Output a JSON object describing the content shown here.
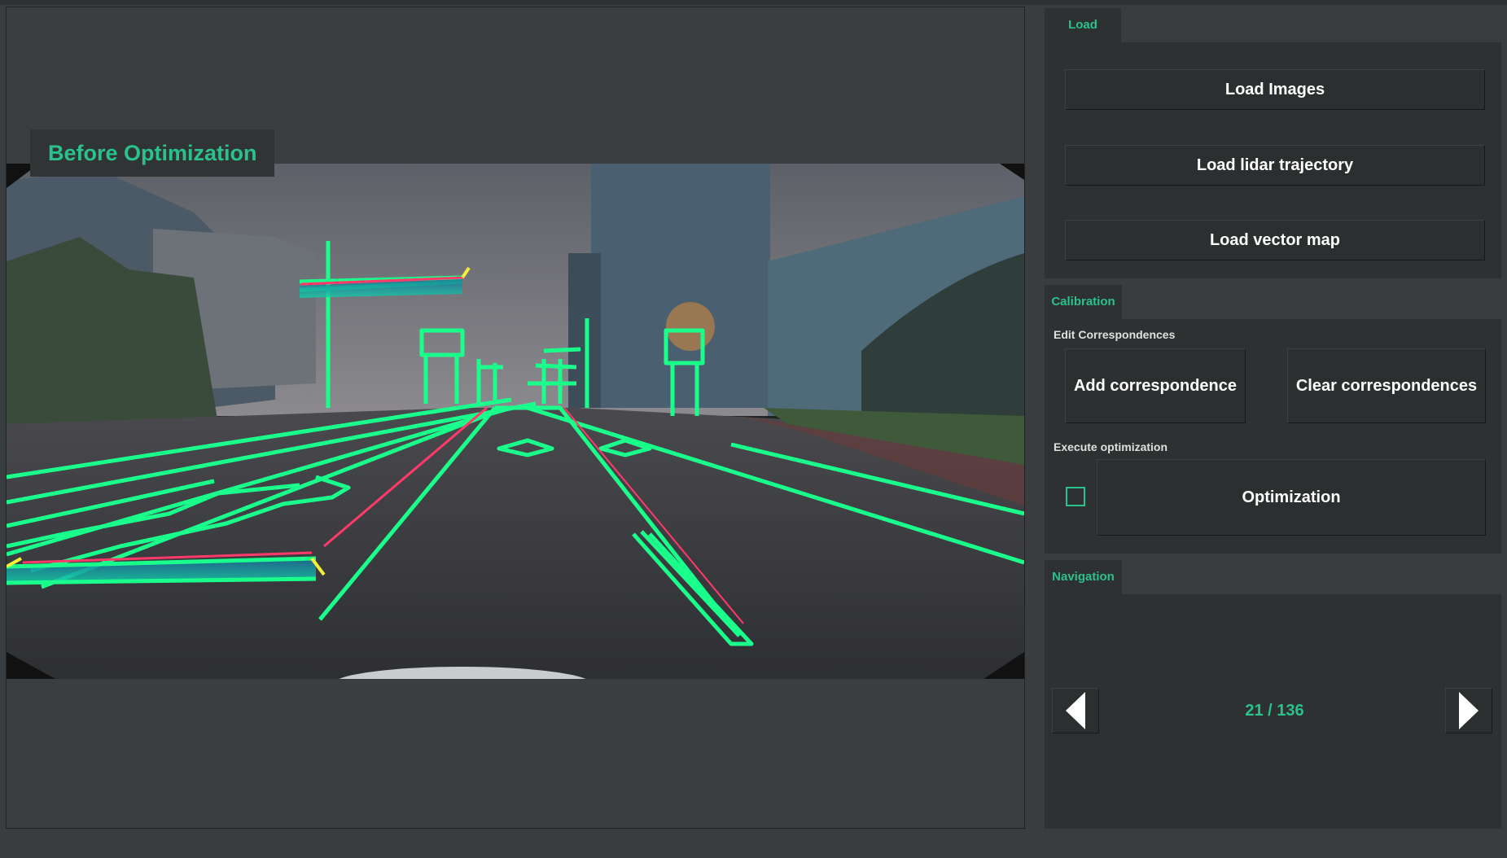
{
  "viewer": {
    "title": "Before Optimization"
  },
  "load": {
    "tab_label": "Load",
    "buttons": [
      "Load Images",
      "Load lidar trajectory",
      "Load vector map"
    ]
  },
  "calibration": {
    "tab_label": "Calibration",
    "edit_label": "Edit Correspondences",
    "add_button": "Add correspondence",
    "clear_button": "Clear correspondences",
    "execute_label": "Execute optimization",
    "optimization_button": "Optimization",
    "optimization_checked": false
  },
  "navigation": {
    "tab_label": "Navigation",
    "counter": "21 / 136"
  },
  "colors": {
    "accent": "#2ac18e",
    "overlay": "#1aff8c",
    "overlay_edge_red": "#ff3a6a",
    "overlay_edge_yellow": "#f2f03a"
  }
}
